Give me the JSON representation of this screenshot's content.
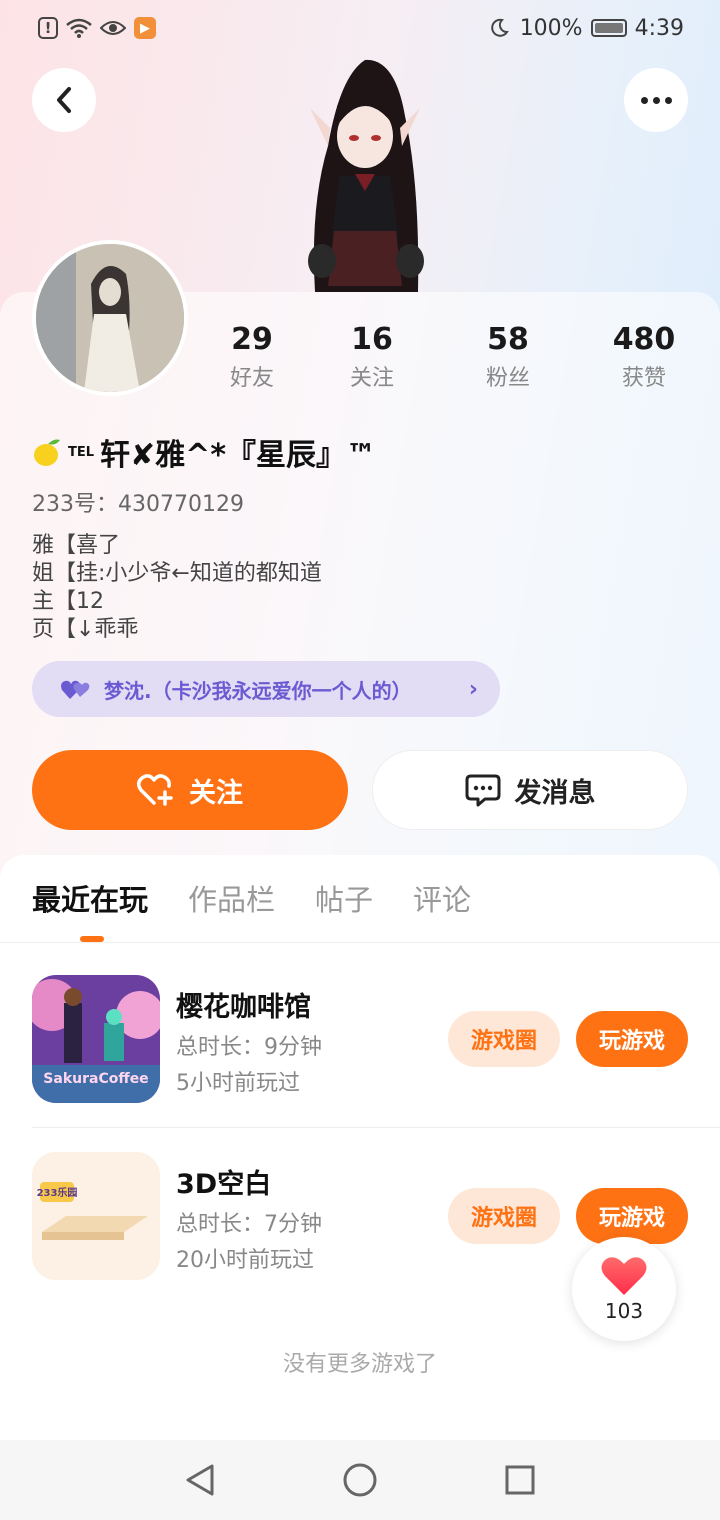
{
  "status_bar": {
    "left_icons": [
      "alert-icon",
      "wifi-icon",
      "eye-icon",
      "video-app-icon"
    ],
    "battery": "100%",
    "time": "4:39"
  },
  "header": {
    "back_icon": "back-arrow-icon",
    "more_icon": "more-dots-icon"
  },
  "profile": {
    "stats": [
      {
        "value": "29",
        "label": "好友"
      },
      {
        "value": "16",
        "label": "关注"
      },
      {
        "value": "58",
        "label": "粉丝"
      },
      {
        "value": "480",
        "label": "获赞"
      }
    ],
    "name_prefix": "TEL",
    "name": "轩✘雅^*『星辰』™",
    "uid": "233号：430770129",
    "bio_lines": [
      "雅【喜了",
      "姐【挂:小少爷←知道的都知道",
      "主【12",
      "页【↓乖乖"
    ],
    "relation_tag": "梦沈.（卡沙我永远爱你一个人的）",
    "follow_label": "关注",
    "message_label": "发消息"
  },
  "tabs": [
    "最近在玩",
    "作品栏",
    "帖子",
    "评论"
  ],
  "games": [
    {
      "title": "樱花咖啡馆",
      "duration": "总时长：9分钟",
      "last_played": "5小时前玩过",
      "icon_text": "SakuraCoffee",
      "circle_label": "游戏圈",
      "play_label": "玩游戏"
    },
    {
      "title": "3D空白",
      "duration": "总时长：7分钟",
      "last_played": "20小时前玩过",
      "icon_text": "233乐园",
      "circle_label": "游戏圈",
      "play_label": "玩游戏"
    }
  ],
  "like_count": "103",
  "no_more_text": "没有更多游戏了",
  "colors": {
    "accent": "#ff7214",
    "tag_bg": "#e2dcf5",
    "tag_text": "#6b5bd2"
  }
}
